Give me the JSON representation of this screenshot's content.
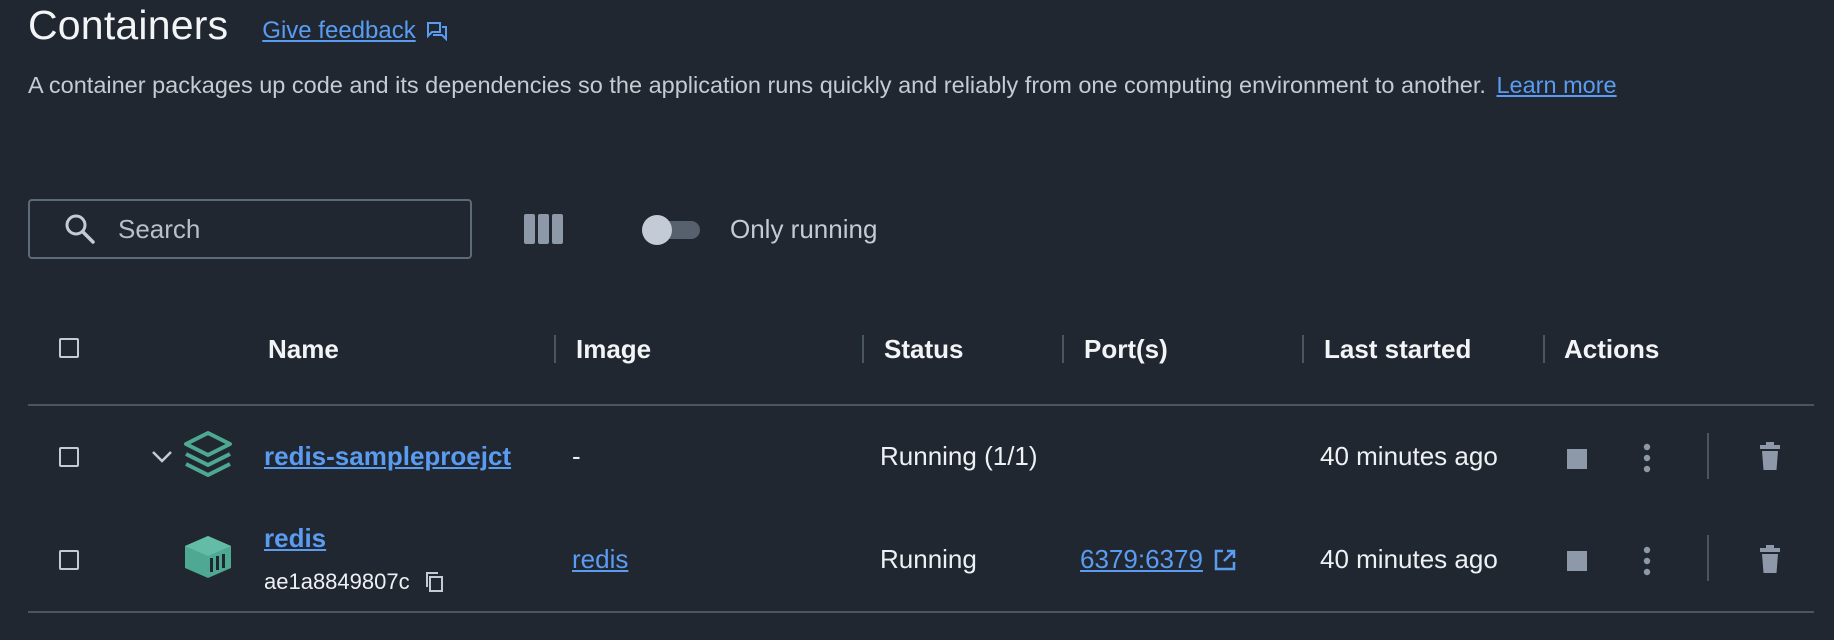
{
  "header": {
    "title": "Containers",
    "feedback_label": "Give feedback",
    "description": "A container packages up code and its dependencies so the application runs quickly and reliably from one computing environment to another.",
    "learn_more_label": "Learn more"
  },
  "toolbar": {
    "search_placeholder": "Search",
    "search_value": "",
    "only_running_label": "Only running",
    "only_running_enabled": false
  },
  "table": {
    "columns": [
      "Name",
      "Image",
      "Status",
      "Port(s)",
      "Last started",
      "Actions"
    ],
    "rows": [
      {
        "kind": "compose-project",
        "name": "redis-sampleproejct",
        "image": "-",
        "status": "Running (1/1)",
        "ports": "",
        "last_started": "40 minutes ago",
        "expanded": true
      },
      {
        "kind": "container",
        "name": "redis",
        "container_id": "ae1a8849807c",
        "image": "redis",
        "status": "Running",
        "ports": "6379:6379",
        "last_started": "40 minutes ago"
      }
    ]
  },
  "colors": {
    "background": "#202730",
    "accent_link": "#5a9cf2",
    "icon_teal": "#4fa892",
    "action_icon": "#8d99a8"
  }
}
